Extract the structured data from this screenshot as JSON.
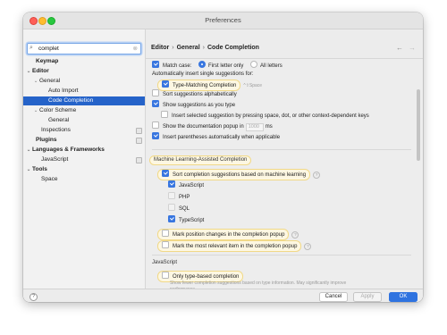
{
  "window": {
    "title": "Preferences"
  },
  "search": {
    "value": "complet",
    "icon": "magnifier-icon"
  },
  "sidebar": {
    "items": [
      {
        "label": "Keymap",
        "bold": true
      },
      {
        "label": "Editor",
        "bold": true,
        "expanded": true
      },
      {
        "label": "General",
        "expanded": true
      },
      {
        "label": "Auto Import"
      },
      {
        "label": "Code Completion",
        "selected": true
      },
      {
        "label": "Color Scheme",
        "expanded": true
      },
      {
        "label": "General"
      },
      {
        "label": "Inspections"
      },
      {
        "label": "Plugins",
        "bold": true
      },
      {
        "label": "Languages & Frameworks",
        "bold": true,
        "expanded": true
      },
      {
        "label": "JavaScript"
      },
      {
        "label": "Tools",
        "bold": true,
        "expanded": true
      },
      {
        "label": "Space"
      }
    ]
  },
  "breadcrumb": {
    "part1": "Editor",
    "part2": "General",
    "part3": "Code Completion",
    "separator": "›"
  },
  "settings": {
    "match_case": "Match case:",
    "first_letter_only": "First letter only",
    "all_letters": "All letters",
    "auto_insert": "Automatically insert single suggestions for:",
    "type_matching": "Type-Matching Completion",
    "type_matching_hint": "^⇧Space",
    "sort_alpha": "Sort suggestions alphabetically",
    "show_as_you_type": "Show suggestions as you type",
    "insert_selected": "Insert selected suggestion by pressing space, dot, or other context-dependent keys",
    "show_doc_popup": "Show the documentation popup in",
    "doc_delay": "1000",
    "doc_unit": "ms",
    "insert_parens": "Insert parentheses automatically when applicable",
    "ml_section": "Machine Learning-Assisted Completion",
    "sort_ml": "Sort completion suggestions based on machine learning",
    "lang_javascript": "JavaScript",
    "lang_php": "PHP",
    "lang_sql": "SQL",
    "lang_typescript": "TypeScript",
    "mark_position": "Mark position changes in the completion popup",
    "mark_relevant": "Mark the most relevant item in the completion popup",
    "js_section": "JavaScript",
    "only_type_based": "Only type-based completion",
    "only_type_based_desc": "Show fewer completion suggestions based on type information. May significantly improve performance."
  },
  "footer": {
    "help": "?",
    "cancel": "Cancel",
    "apply": "Apply",
    "ok": "OK"
  },
  "colors": {
    "accent": "#2f73e0",
    "highlight_fill": "#fdf7e2",
    "highlight_border": "#f1d988"
  }
}
